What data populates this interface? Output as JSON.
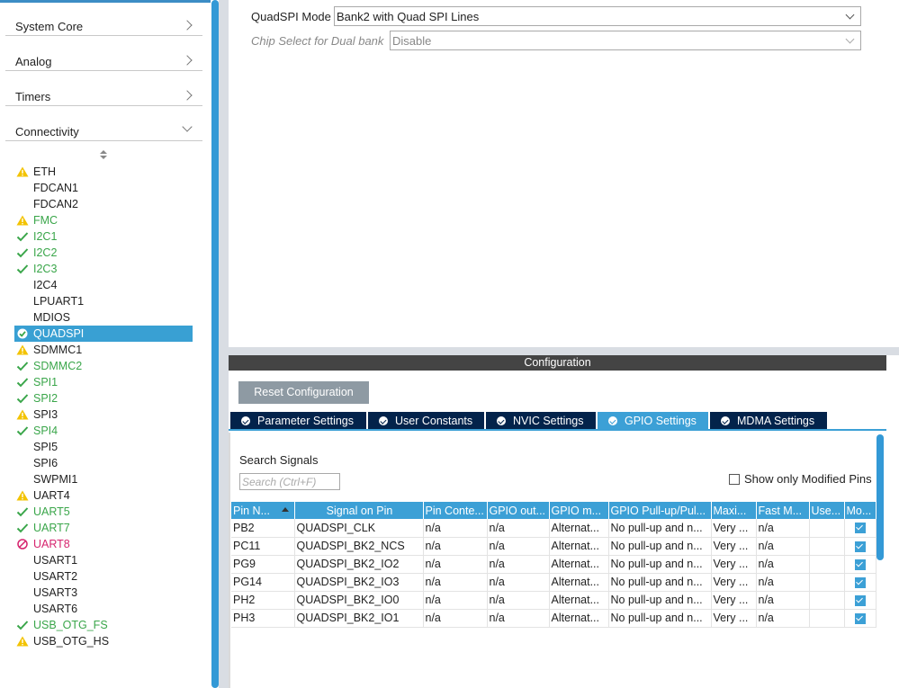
{
  "sidebar": {
    "categories": [
      {
        "label": "System Core",
        "expanded": false
      },
      {
        "label": "Analog",
        "expanded": false
      },
      {
        "label": "Timers",
        "expanded": false
      },
      {
        "label": "Connectivity",
        "expanded": true
      }
    ],
    "peripherals": [
      {
        "name": "ETH",
        "status": "warning"
      },
      {
        "name": "FDCAN1",
        "status": "none"
      },
      {
        "name": "FDCAN2",
        "status": "none"
      },
      {
        "name": "FMC",
        "status": "warning"
      },
      {
        "name": "I2C1",
        "status": "ok"
      },
      {
        "name": "I2C2",
        "status": "ok"
      },
      {
        "name": "I2C3",
        "status": "ok"
      },
      {
        "name": "I2C4",
        "status": "none"
      },
      {
        "name": "LPUART1",
        "status": "none"
      },
      {
        "name": "MDIOS",
        "status": "none"
      },
      {
        "name": "QUADSPI",
        "status": "selected"
      },
      {
        "name": "SDMMC1",
        "status": "warning"
      },
      {
        "name": "SDMMC2",
        "status": "ok"
      },
      {
        "name": "SPI1",
        "status": "ok"
      },
      {
        "name": "SPI2",
        "status": "ok"
      },
      {
        "name": "SPI3",
        "status": "warning"
      },
      {
        "name": "SPI4",
        "status": "ok"
      },
      {
        "name": "SPI5",
        "status": "none"
      },
      {
        "name": "SPI6",
        "status": "none"
      },
      {
        "name": "SWPMI1",
        "status": "none"
      },
      {
        "name": "UART4",
        "status": "warning"
      },
      {
        "name": "UART5",
        "status": "ok"
      },
      {
        "name": "UART7",
        "status": "ok"
      },
      {
        "name": "UART8",
        "status": "blocked"
      },
      {
        "name": "USART1",
        "status": "none"
      },
      {
        "name": "USART2",
        "status": "none"
      },
      {
        "name": "USART3",
        "status": "none"
      },
      {
        "name": "USART6",
        "status": "none"
      },
      {
        "name": "USB_OTG_FS",
        "status": "ok"
      },
      {
        "name": "USB_OTG_HS",
        "status": "warning"
      }
    ]
  },
  "mode": {
    "quadspi_mode_label": "QuadSPI Mode",
    "quadspi_mode_value": "Bank2 with Quad SPI Lines",
    "chip_select_label": "Chip Select for Dual bank",
    "chip_select_value": "Disable"
  },
  "config": {
    "header": "Configuration",
    "reset_label": "Reset Configuration",
    "tabs": [
      {
        "label": "Parameter Settings",
        "active": false
      },
      {
        "label": "User Constants",
        "active": false
      },
      {
        "label": "NVIC Settings",
        "active": false
      },
      {
        "label": "GPIO Settings",
        "active": true
      },
      {
        "label": "MDMA Settings",
        "active": false
      }
    ],
    "search_label": "Search Signals",
    "search_placeholder": "Search (Ctrl+F)",
    "show_modified_label": "Show only Modified Pins",
    "columns": [
      "Pin N...",
      "Signal on Pin",
      "Pin Conte...",
      "GPIO out...",
      "GPIO m...",
      "GPIO Pull-up/Pul...",
      "Maxi...",
      "Fast M...",
      "Use...",
      "Mo..."
    ],
    "rows": [
      [
        "PB2",
        "QUADSPI_CLK",
        "n/a",
        "n/a",
        "Alternat...",
        "No pull-up and n...",
        "Very ...",
        "n/a",
        "",
        true
      ],
      [
        "PC11",
        "QUADSPI_BK2_NCS",
        "n/a",
        "n/a",
        "Alternat...",
        "No pull-up and n...",
        "Very ...",
        "n/a",
        "",
        true
      ],
      [
        "PG9",
        "QUADSPI_BK2_IO2",
        "n/a",
        "n/a",
        "Alternat...",
        "No pull-up and n...",
        "Very ...",
        "n/a",
        "",
        true
      ],
      [
        "PG14",
        "QUADSPI_BK2_IO3",
        "n/a",
        "n/a",
        "Alternat...",
        "No pull-up and n...",
        "Very ...",
        "n/a",
        "",
        true
      ],
      [
        "PH2",
        "QUADSPI_BK2_IO0",
        "n/a",
        "n/a",
        "Alternat...",
        "No pull-up and n...",
        "Very ...",
        "n/a",
        "",
        true
      ],
      [
        "PH3",
        "QUADSPI_BK2_IO1",
        "n/a",
        "n/a",
        "Alternat...",
        "No pull-up and n...",
        "Very ...",
        "n/a",
        "",
        true
      ]
    ]
  },
  "colors": {
    "ok": "#3aa64a",
    "warning": "#f3c300",
    "blocked": "#d6246e",
    "selected": "#39a0d3",
    "tab_dark": "#03234b",
    "tab_active": "#3ca0d6"
  }
}
